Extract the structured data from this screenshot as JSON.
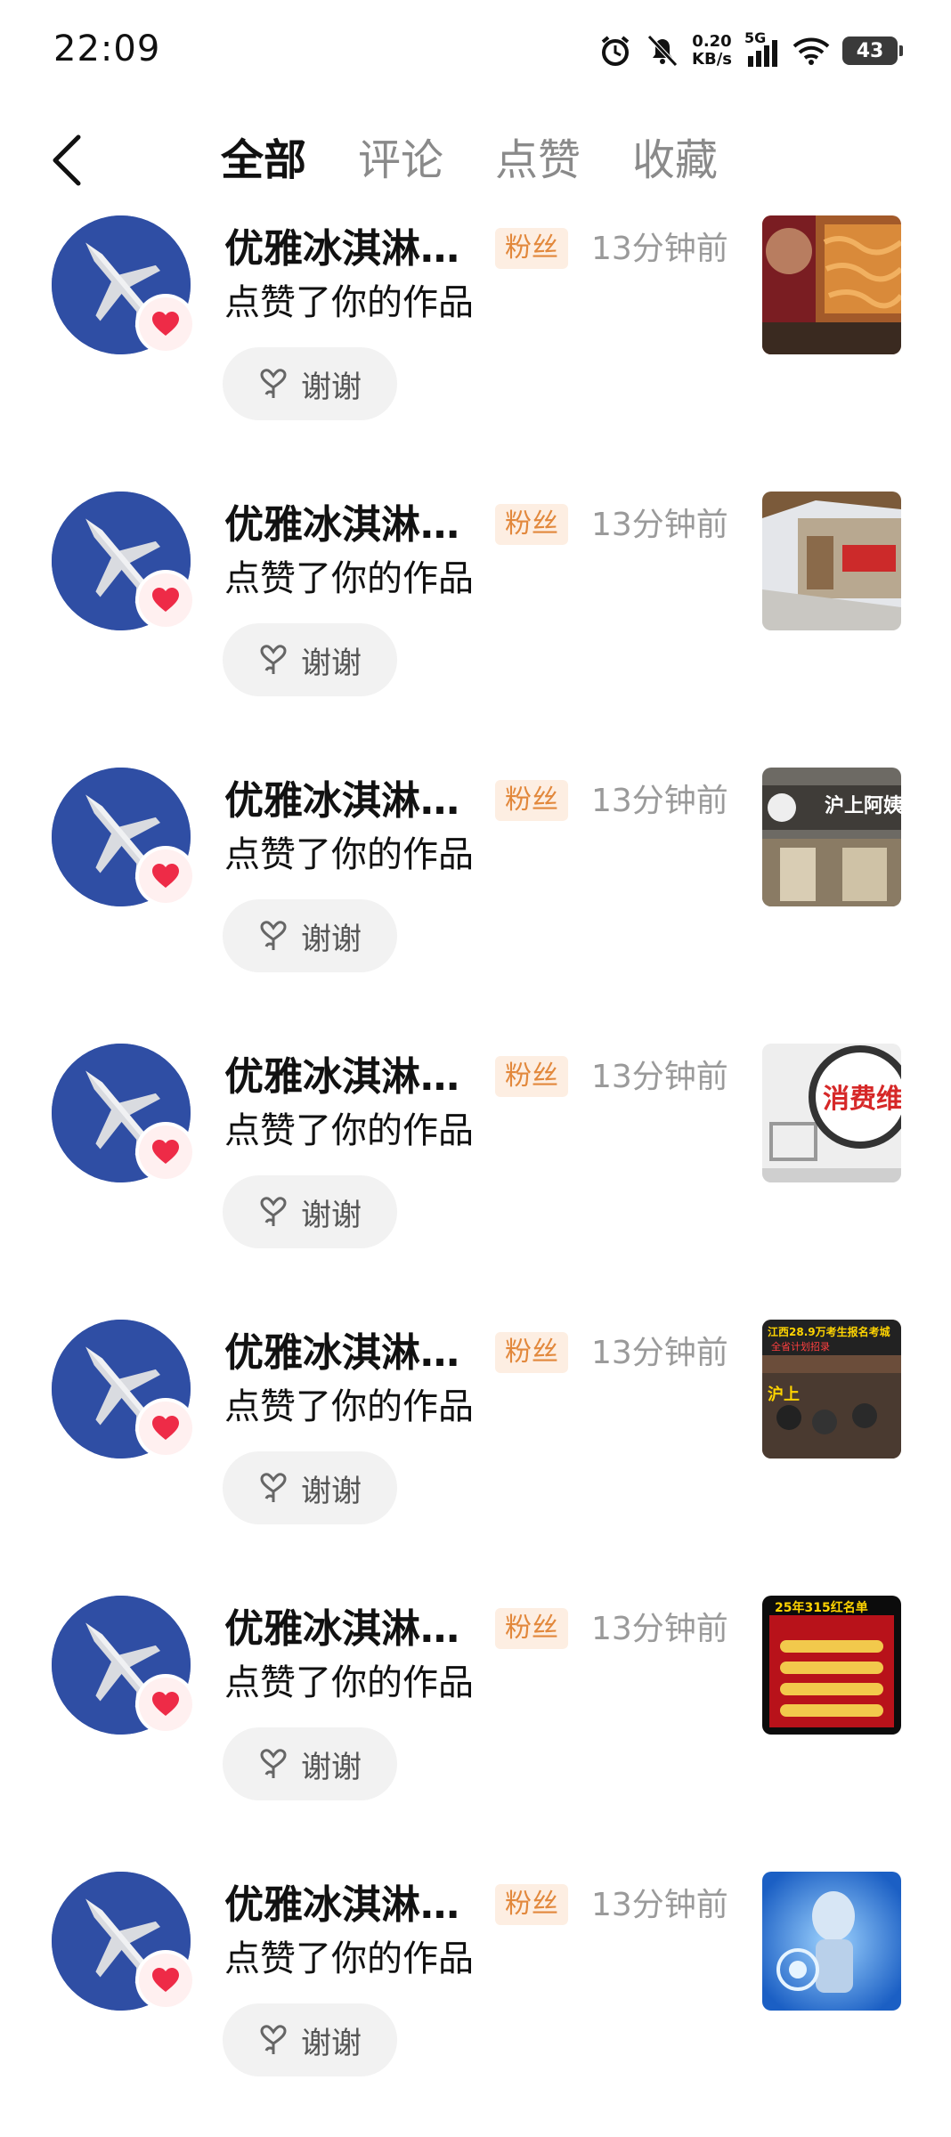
{
  "status": {
    "time": "22:09",
    "speed_value": "0.20",
    "speed_unit": "KB/s",
    "network": "5G",
    "battery": "43"
  },
  "header": {
    "tabs": [
      "全部",
      "评论",
      "点赞",
      "收藏"
    ],
    "active_tab": 0
  },
  "notifications": [
    {
      "username": "优雅冰淇淋…",
      "badge": "粉丝",
      "time": "13分钟前",
      "action": "点赞了你的作品",
      "button": "谢谢",
      "thumb": "food"
    },
    {
      "username": "优雅冰淇淋…",
      "badge": "粉丝",
      "time": "13分钟前",
      "action": "点赞了你的作品",
      "button": "谢谢",
      "thumb": "street"
    },
    {
      "username": "优雅冰淇淋…",
      "badge": "粉丝",
      "time": "13分钟前",
      "action": "点赞了你的作品",
      "button": "谢谢",
      "thumb": "storefront"
    },
    {
      "username": "优雅冰淇淋…",
      "badge": "粉丝",
      "time": "13分钟前",
      "action": "点赞了你的作品",
      "button": "谢谢",
      "thumb": "consumer",
      "thumb_text": "消费维"
    },
    {
      "username": "优雅冰淇淋…",
      "badge": "粉丝",
      "time": "13分钟前",
      "action": "点赞了你的作品",
      "button": "谢谢",
      "thumb": "exam-poster",
      "thumb_text": "江西28.9万考生报名考城"
    },
    {
      "username": "优雅冰淇淋…",
      "badge": "粉丝",
      "time": "13分钟前",
      "action": "点赞了你的作品",
      "button": "谢谢",
      "thumb": "red-list",
      "thumb_text": "25年315红名单"
    },
    {
      "username": "优雅冰淇淋…",
      "badge": "粉丝",
      "time": "13分钟前",
      "action": "点赞了你的作品",
      "button": "谢谢",
      "thumb": "robot"
    }
  ],
  "colors": {
    "badge_bg": "#fdeee2",
    "badge_text": "#e2883c",
    "heart": "#ee2b47",
    "avatar_bg": "#2f4ea4"
  }
}
